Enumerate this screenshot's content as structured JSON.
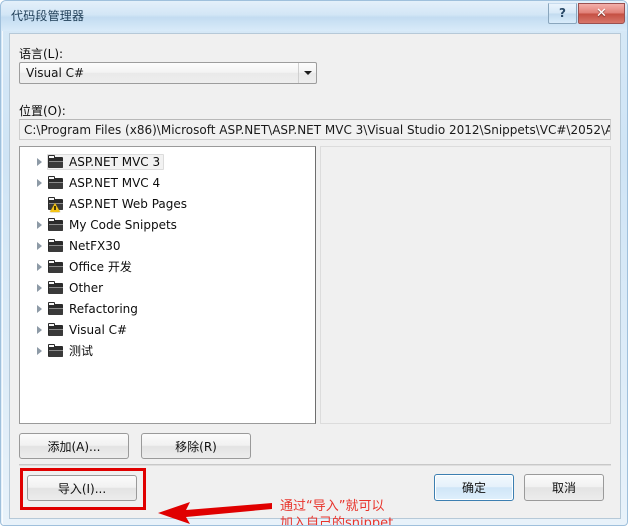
{
  "window": {
    "title": "代码段管理器",
    "help_button": "?",
    "close_button": "✕",
    "help_icon": "question-mark-icon",
    "close_icon": "close-x-icon"
  },
  "form": {
    "language_label": "语言(L):",
    "language_value": "Visual C#",
    "location_label": "位置(O):",
    "location_value": "C:\\Program Files (x86)\\Microsoft ASP.NET\\ASP.NET MVC 3\\Visual Studio 2012\\Snippets\\VC#\\2052\\A"
  },
  "tree": {
    "items": [
      {
        "label": "ASP.NET MVC 3",
        "expandable": true,
        "selected": true,
        "warning": false
      },
      {
        "label": "ASP.NET MVC 4",
        "expandable": true,
        "selected": false,
        "warning": false
      },
      {
        "label": "ASP.NET Web Pages",
        "expandable": false,
        "selected": false,
        "warning": true
      },
      {
        "label": "My Code Snippets",
        "expandable": true,
        "selected": false,
        "warning": false
      },
      {
        "label": "NetFX30",
        "expandable": true,
        "selected": false,
        "warning": false
      },
      {
        "label": "Office 开发",
        "expandable": true,
        "selected": false,
        "warning": false
      },
      {
        "label": "Other",
        "expandable": true,
        "selected": false,
        "warning": false
      },
      {
        "label": "Refactoring",
        "expandable": true,
        "selected": false,
        "warning": false
      },
      {
        "label": "Visual C#",
        "expandable": true,
        "selected": false,
        "warning": false
      },
      {
        "label": "测试",
        "expandable": true,
        "selected": false,
        "warning": false
      }
    ]
  },
  "buttons": {
    "add": "添加(A)...",
    "remove": "移除(R)",
    "import": "导入(I)...",
    "ok": "确定",
    "cancel": "取消"
  },
  "annotation": {
    "text": "通过“导入”就可以\n加入自己的snippet",
    "color": "#e8342c",
    "box_color": "#e00000",
    "arrow_icon": "left-arrow-icon"
  }
}
